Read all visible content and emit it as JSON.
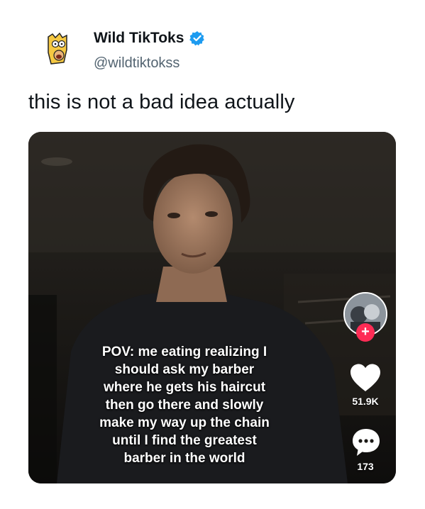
{
  "tweet": {
    "author": {
      "display_name": "Wild TikToks",
      "handle": "@wildtiktokss",
      "verified": true,
      "avatar_icon": "cartoon-avatar-icon"
    },
    "text": "this is not a bad idea actually",
    "accent_color": "#1d9bf0"
  },
  "video": {
    "caption_lines": [
      "POV: me eating realizing I",
      "should ask my barber",
      "where he gets his haircut",
      "then go there and slowly",
      "make my way up the chain",
      "until I find the greatest",
      "barber in the world"
    ],
    "actions": {
      "follow_symbol": "+",
      "likes": "51.9K",
      "comments": "173",
      "like_icon": "heart-icon",
      "comment_icon": "comment-bubble-icon",
      "follow_color": "#fe2c55"
    }
  }
}
